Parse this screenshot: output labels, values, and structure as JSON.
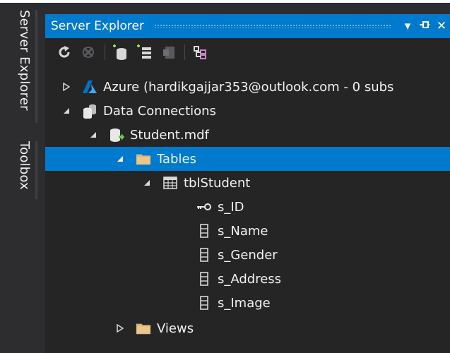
{
  "sidebar_tabs": {
    "server_explorer": "Server Explorer",
    "toolbox": "Toolbox"
  },
  "panel": {
    "title": "Server Explorer",
    "title_buttons": [
      "▾",
      "⊣",
      "✕"
    ]
  },
  "toolbar": {
    "icons": [
      "refresh-icon",
      "stop-refresh-icon",
      "connect-to-database-icon",
      "connect-to-server-icon",
      "connect-to-sharepoint-icon",
      "show-data-connection-schema-icon"
    ]
  },
  "tree": {
    "azure": "Azure (hardikgajjar353@outlook.com - 0 subs",
    "data_connections": "Data Connections",
    "student_mdf": "Student.mdf",
    "tables": "Tables",
    "tbl_student": "tblStudent",
    "columns": [
      "s_ID",
      "s_Name",
      "s_Gender",
      "s_Address",
      "s_Image"
    ],
    "views": "Views"
  },
  "colors": {
    "accent": "#007acc",
    "panel_bg": "#252526",
    "frame_bg": "#2d2d30",
    "text": "#f1f1f1",
    "folder": "#dcb67a"
  }
}
